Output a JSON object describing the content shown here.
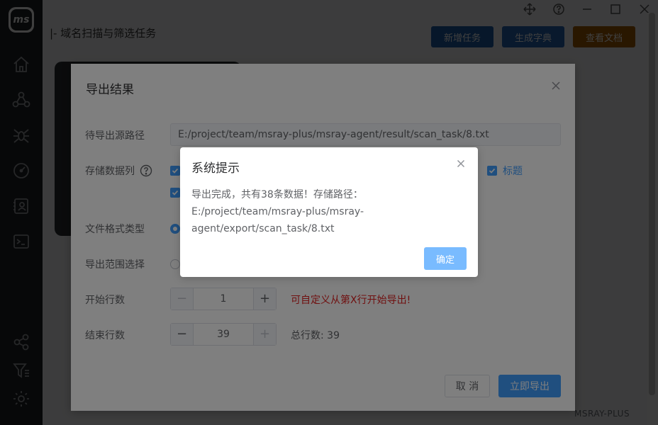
{
  "app": {
    "logo_text": "ms",
    "page_title": "|- 域名扫描与筛选任务",
    "watermark": "MSRAY-PLUS"
  },
  "sidebar": {
    "icons": [
      "home-icon",
      "network-icon",
      "spider-icon",
      "gauge-icon",
      "contact-card-icon",
      "terminal-icon",
      "share-icon",
      "filter-icon",
      "settings-icon"
    ]
  },
  "window_controls": [
    "move-icon",
    "help-icon",
    "minimize-icon",
    "maximize-icon",
    "close-icon"
  ],
  "toolbar": {
    "new_task": "新增任务",
    "gen_dict": "生成字典",
    "view_docs": "查看文档"
  },
  "colors": {
    "primary": "#409eff",
    "primary_light": "#79bbff",
    "btn_new": "#1f5fa8",
    "btn_dict": "#2567b7",
    "btn_docs": "#a65f00",
    "danger": "#e02020"
  },
  "export_dialog": {
    "title": "导出结果",
    "source_path_label": "待导出源路径",
    "source_path_value": "E:/project/team/msray-plus/msray-agent/result/scan_task/8.txt",
    "columns_label": "存储数据列",
    "checkbox_visible_label": "标题",
    "format_label": "文件格式类型",
    "range_label": "导出范围选择",
    "start_row_label": "开始行数",
    "start_row_value": "1",
    "start_row_hint": "可自定义从第X行开始导出!",
    "end_row_label": "结束行数",
    "end_row_value": "39",
    "total_rows_text": "总行数: 39",
    "cancel_label": "取 消",
    "export_label": "立即导出"
  },
  "message_box": {
    "title": "系统提示",
    "message_line1": "导出完成，共有38条数据！存储路径：",
    "message_line2": "E:/project/team/msray-plus/msray-",
    "message_line3": "agent/export/scan_task/8.txt",
    "confirm_label": "确定"
  }
}
